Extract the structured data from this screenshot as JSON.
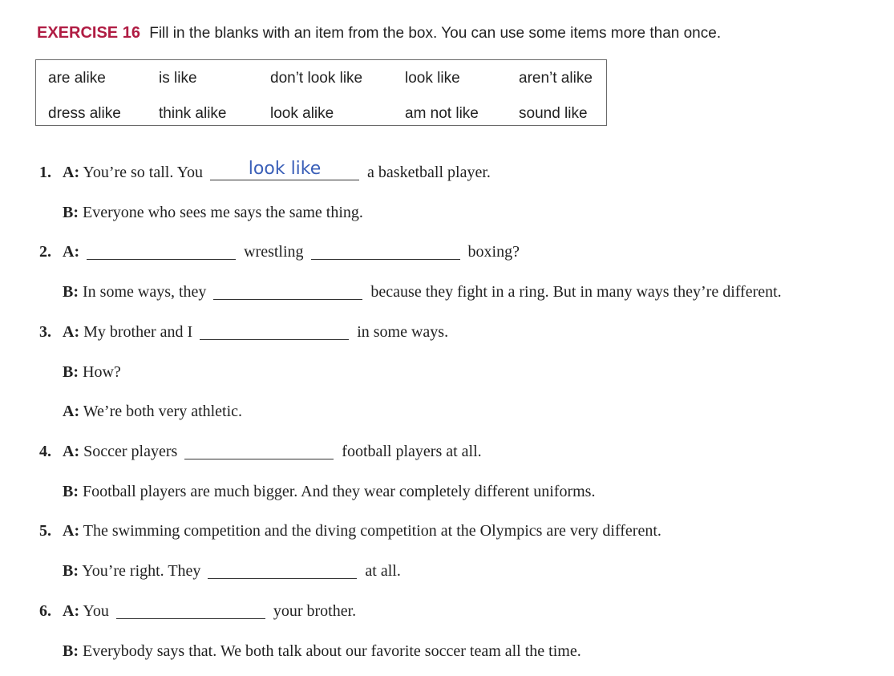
{
  "exercise": {
    "label": "EXERCISE 16",
    "instruction": "Fill in the blanks with an item from the box. You can use some items more than once."
  },
  "box_items": [
    "are alike",
    "is like",
    "don’t look like",
    "look like",
    "aren’t alike",
    "dress alike",
    "think alike",
    "look alike",
    "am not like",
    "sound like"
  ],
  "items": [
    {
      "num": "1.",
      "a1": "You’re so tall. You",
      "answer": "look like",
      "a2": "a basketball player.",
      "b": "Everyone who sees me says the same thing."
    },
    {
      "num": "2.",
      "a1": "wrestling",
      "a2": "boxing?",
      "b1": "In some ways, they",
      "b2": "because they fight in a ring. But in many ways they’re different."
    },
    {
      "num": "3.",
      "a1": "My brother and I",
      "a2": "in some ways.",
      "b": "How?",
      "a3": "We’re both very athletic."
    },
    {
      "num": "4.",
      "a1": "Soccer players",
      "a2": "football players at all.",
      "b": "Football players are much bigger. And they wear completely different uniforms."
    },
    {
      "num": "5.",
      "a1": "The swimming competition and the diving competition at the Olympics are very different.",
      "b1": "You’re right. They",
      "b2": "at all."
    },
    {
      "num": "6.",
      "a1": "You",
      "a2": "your brother.",
      "b": "Everybody says that. We both talk about our favorite soccer team all the time."
    }
  ],
  "speaker_a": "A:",
  "speaker_b": "B:"
}
